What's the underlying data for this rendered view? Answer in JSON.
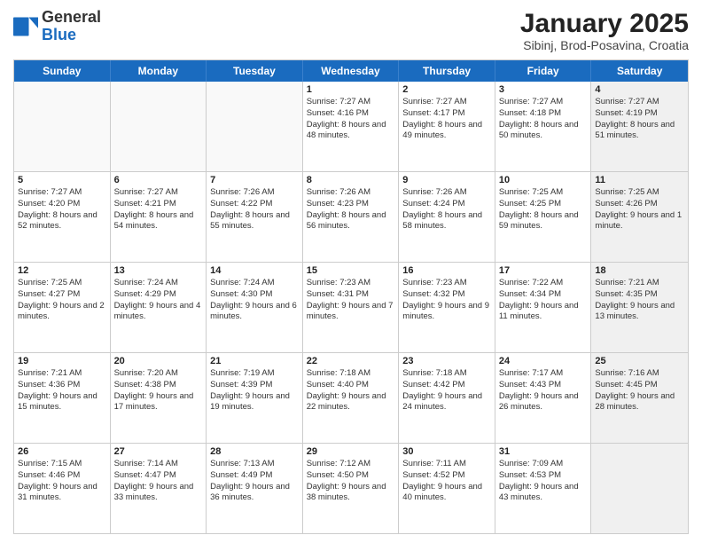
{
  "header": {
    "logo_general": "General",
    "logo_blue": "Blue",
    "title": "January 2025",
    "subtitle": "Sibinj, Brod-Posavina, Croatia"
  },
  "weekdays": [
    "Sunday",
    "Monday",
    "Tuesday",
    "Wednesday",
    "Thursday",
    "Friday",
    "Saturday"
  ],
  "weeks": [
    [
      {
        "day": "",
        "sunrise": "",
        "sunset": "",
        "daylight": "",
        "empty": true
      },
      {
        "day": "",
        "sunrise": "",
        "sunset": "",
        "daylight": "",
        "empty": true
      },
      {
        "day": "",
        "sunrise": "",
        "sunset": "",
        "daylight": "",
        "empty": true
      },
      {
        "day": "1",
        "sunrise": "Sunrise: 7:27 AM",
        "sunset": "Sunset: 4:16 PM",
        "daylight": "Daylight: 8 hours and 48 minutes."
      },
      {
        "day": "2",
        "sunrise": "Sunrise: 7:27 AM",
        "sunset": "Sunset: 4:17 PM",
        "daylight": "Daylight: 8 hours and 49 minutes."
      },
      {
        "day": "3",
        "sunrise": "Sunrise: 7:27 AM",
        "sunset": "Sunset: 4:18 PM",
        "daylight": "Daylight: 8 hours and 50 minutes."
      },
      {
        "day": "4",
        "sunrise": "Sunrise: 7:27 AM",
        "sunset": "Sunset: 4:19 PM",
        "daylight": "Daylight: 8 hours and 51 minutes.",
        "shaded": true
      }
    ],
    [
      {
        "day": "5",
        "sunrise": "Sunrise: 7:27 AM",
        "sunset": "Sunset: 4:20 PM",
        "daylight": "Daylight: 8 hours and 52 minutes."
      },
      {
        "day": "6",
        "sunrise": "Sunrise: 7:27 AM",
        "sunset": "Sunset: 4:21 PM",
        "daylight": "Daylight: 8 hours and 54 minutes."
      },
      {
        "day": "7",
        "sunrise": "Sunrise: 7:26 AM",
        "sunset": "Sunset: 4:22 PM",
        "daylight": "Daylight: 8 hours and 55 minutes."
      },
      {
        "day": "8",
        "sunrise": "Sunrise: 7:26 AM",
        "sunset": "Sunset: 4:23 PM",
        "daylight": "Daylight: 8 hours and 56 minutes."
      },
      {
        "day": "9",
        "sunrise": "Sunrise: 7:26 AM",
        "sunset": "Sunset: 4:24 PM",
        "daylight": "Daylight: 8 hours and 58 minutes."
      },
      {
        "day": "10",
        "sunrise": "Sunrise: 7:25 AM",
        "sunset": "Sunset: 4:25 PM",
        "daylight": "Daylight: 8 hours and 59 minutes."
      },
      {
        "day": "11",
        "sunrise": "Sunrise: 7:25 AM",
        "sunset": "Sunset: 4:26 PM",
        "daylight": "Daylight: 9 hours and 1 minute.",
        "shaded": true
      }
    ],
    [
      {
        "day": "12",
        "sunrise": "Sunrise: 7:25 AM",
        "sunset": "Sunset: 4:27 PM",
        "daylight": "Daylight: 9 hours and 2 minutes."
      },
      {
        "day": "13",
        "sunrise": "Sunrise: 7:24 AM",
        "sunset": "Sunset: 4:29 PM",
        "daylight": "Daylight: 9 hours and 4 minutes."
      },
      {
        "day": "14",
        "sunrise": "Sunrise: 7:24 AM",
        "sunset": "Sunset: 4:30 PM",
        "daylight": "Daylight: 9 hours and 6 minutes."
      },
      {
        "day": "15",
        "sunrise": "Sunrise: 7:23 AM",
        "sunset": "Sunset: 4:31 PM",
        "daylight": "Daylight: 9 hours and 7 minutes."
      },
      {
        "day": "16",
        "sunrise": "Sunrise: 7:23 AM",
        "sunset": "Sunset: 4:32 PM",
        "daylight": "Daylight: 9 hours and 9 minutes."
      },
      {
        "day": "17",
        "sunrise": "Sunrise: 7:22 AM",
        "sunset": "Sunset: 4:34 PM",
        "daylight": "Daylight: 9 hours and 11 minutes."
      },
      {
        "day": "18",
        "sunrise": "Sunrise: 7:21 AM",
        "sunset": "Sunset: 4:35 PM",
        "daylight": "Daylight: 9 hours and 13 minutes.",
        "shaded": true
      }
    ],
    [
      {
        "day": "19",
        "sunrise": "Sunrise: 7:21 AM",
        "sunset": "Sunset: 4:36 PM",
        "daylight": "Daylight: 9 hours and 15 minutes."
      },
      {
        "day": "20",
        "sunrise": "Sunrise: 7:20 AM",
        "sunset": "Sunset: 4:38 PM",
        "daylight": "Daylight: 9 hours and 17 minutes."
      },
      {
        "day": "21",
        "sunrise": "Sunrise: 7:19 AM",
        "sunset": "Sunset: 4:39 PM",
        "daylight": "Daylight: 9 hours and 19 minutes."
      },
      {
        "day": "22",
        "sunrise": "Sunrise: 7:18 AM",
        "sunset": "Sunset: 4:40 PM",
        "daylight": "Daylight: 9 hours and 22 minutes."
      },
      {
        "day": "23",
        "sunrise": "Sunrise: 7:18 AM",
        "sunset": "Sunset: 4:42 PM",
        "daylight": "Daylight: 9 hours and 24 minutes."
      },
      {
        "day": "24",
        "sunrise": "Sunrise: 7:17 AM",
        "sunset": "Sunset: 4:43 PM",
        "daylight": "Daylight: 9 hours and 26 minutes."
      },
      {
        "day": "25",
        "sunrise": "Sunrise: 7:16 AM",
        "sunset": "Sunset: 4:45 PM",
        "daylight": "Daylight: 9 hours and 28 minutes.",
        "shaded": true
      }
    ],
    [
      {
        "day": "26",
        "sunrise": "Sunrise: 7:15 AM",
        "sunset": "Sunset: 4:46 PM",
        "daylight": "Daylight: 9 hours and 31 minutes."
      },
      {
        "day": "27",
        "sunrise": "Sunrise: 7:14 AM",
        "sunset": "Sunset: 4:47 PM",
        "daylight": "Daylight: 9 hours and 33 minutes."
      },
      {
        "day": "28",
        "sunrise": "Sunrise: 7:13 AM",
        "sunset": "Sunset: 4:49 PM",
        "daylight": "Daylight: 9 hours and 36 minutes."
      },
      {
        "day": "29",
        "sunrise": "Sunrise: 7:12 AM",
        "sunset": "Sunset: 4:50 PM",
        "daylight": "Daylight: 9 hours and 38 minutes."
      },
      {
        "day": "30",
        "sunrise": "Sunrise: 7:11 AM",
        "sunset": "Sunset: 4:52 PM",
        "daylight": "Daylight: 9 hours and 40 minutes."
      },
      {
        "day": "31",
        "sunrise": "Sunrise: 7:09 AM",
        "sunset": "Sunset: 4:53 PM",
        "daylight": "Daylight: 9 hours and 43 minutes."
      },
      {
        "day": "",
        "sunrise": "",
        "sunset": "",
        "daylight": "",
        "empty": true,
        "shaded": true
      }
    ]
  ]
}
